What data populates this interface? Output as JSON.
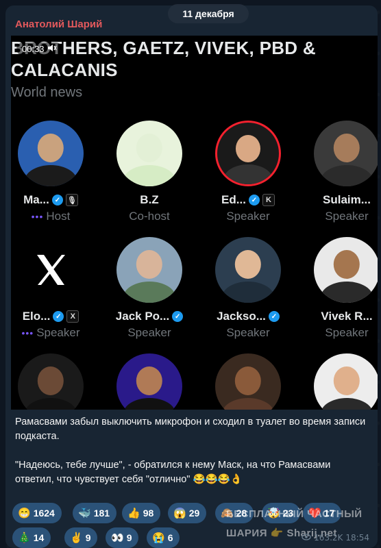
{
  "header": {
    "sender": "Анатолий Шарий",
    "date": "11 декабря"
  },
  "media": {
    "title_line1": "BROTHERS, GAETZ, VIVEK, PBD &",
    "title_line2": "CALACANIS",
    "subtitle": "World news",
    "timer": "00:33",
    "speakers": [
      {
        "name": "Ma...",
        "role": "Host",
        "verified": true,
        "badge": "🎙",
        "avatar_colors": [
          "#2a5fb0",
          "#1b1b1b",
          "#c9a27e"
        ]
      },
      {
        "name": "B.Z",
        "role": "Co-host",
        "verified": false,
        "badge": "",
        "avatar_colors": [
          "#e8f3dc",
          "#d6ecc5",
          "#e3f0d6"
        ]
      },
      {
        "name": "Ed...",
        "role": "Speaker",
        "verified": true,
        "badge": "K",
        "avatar_colors": [
          "#1a1a1a",
          "#333",
          "#d9a884"
        ]
      },
      {
        "name": "Sulaim...",
        "role": "Speaker",
        "verified": false,
        "badge": "",
        "avatar_colors": [
          "#3a3a3a",
          "#2b2b2b",
          "#a67c5b"
        ]
      },
      {
        "name": "Elo...",
        "role": "Speaker",
        "verified": true,
        "badge": "X",
        "avatar_colors": [
          "#000",
          "#000",
          "#000"
        ]
      },
      {
        "name": "Jack Po...",
        "role": "Speaker",
        "verified": true,
        "badge": "",
        "avatar_colors": [
          "#8aa3b8",
          "#5a7a5a",
          "#d8b49a"
        ]
      },
      {
        "name": "Jackso...",
        "role": "Speaker",
        "verified": true,
        "badge": "",
        "avatar_colors": [
          "#2c3e50",
          "#1f2d3a",
          "#e0b896"
        ]
      },
      {
        "name": "Vivek R...",
        "role": "Speaker",
        "verified": false,
        "badge": "",
        "avatar_colors": [
          "#e9e9e9",
          "#2a2a2a",
          "#a5764f"
        ]
      },
      {
        "name": "",
        "role": "",
        "verified": false,
        "badge": "",
        "avatar_colors": [
          "#1a1a1a",
          "#111",
          "#6b4a36"
        ]
      },
      {
        "name": "",
        "role": "",
        "verified": false,
        "badge": "",
        "avatar_colors": [
          "#2a1a8a",
          "#111",
          "#b07a56"
        ]
      },
      {
        "name": "",
        "role": "",
        "verified": false,
        "badge": "",
        "avatar_colors": [
          "#3a2a20",
          "#5a3a2a",
          "#8a5a3a"
        ]
      },
      {
        "name": "",
        "role": "",
        "verified": false,
        "badge": "",
        "avatar_colors": [
          "#ededed",
          "#2a2a2a",
          "#e0b08c"
        ]
      }
    ]
  },
  "message": {
    "paragraph1": "Рамасвами забыл выключить микрофон и сходил в туалет во время записи подкаста.",
    "paragraph2": "\"Надеюсь, тебе лучше\", - обратился к нему Маск, на что Рамасвами ответил, что чувствует себя \"отлично\" 😂😂😂👌"
  },
  "reactions": [
    {
      "emoji": "😁",
      "count": "1624"
    },
    {
      "emoji": "🐳",
      "count": "181"
    },
    {
      "emoji": "👍",
      "count": "98"
    },
    {
      "emoji": "😱",
      "count": "29"
    },
    {
      "emoji": "🙈",
      "count": "28"
    },
    {
      "emoji": "🤯",
      "count": "23"
    },
    {
      "emoji": "❤️",
      "count": "17"
    },
    {
      "emoji": "🎄",
      "count": "14"
    },
    {
      "emoji": "✌️",
      "count": "9"
    },
    {
      "emoji": "👀",
      "count": "9"
    },
    {
      "emoji": "😭",
      "count": "6"
    }
  ],
  "meta": {
    "views": "163.2K",
    "time": "18:54"
  },
  "watermark": {
    "line1": "БЕСПЛАТНЫЙ ЧАСТНЫЙ",
    "line2": "ШАРИЯ 👉 Sharij.net"
  }
}
